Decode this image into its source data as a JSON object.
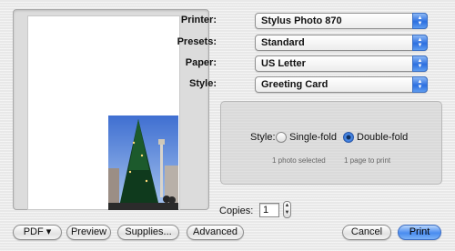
{
  "printer": {
    "label": "Printer:",
    "value": "Stylus Photo 870"
  },
  "presets": {
    "label": "Presets:",
    "value": "Standard"
  },
  "paper": {
    "label": "Paper:",
    "value": "US Letter"
  },
  "style": {
    "label": "Style:",
    "value": "Greeting Card"
  },
  "style_options": {
    "label": "Style:",
    "single_fold": "Single-fold",
    "double_fold": "Double-fold",
    "selected": "Double-fold",
    "photos_selected": "1 photo selected",
    "pages_to_print": "1 page to print"
  },
  "copies": {
    "label": "Copies:",
    "value": "1"
  },
  "buttons": {
    "pdf": "PDF ▾",
    "preview": "Preview",
    "supplies": "Supplies...",
    "advanced": "Advanced",
    "cancel": "Cancel",
    "print": "Print"
  },
  "colors": {
    "accent": "#2c6fe0",
    "background": "#e8e8e8"
  },
  "icons": {
    "popup_arrows": "up-down-arrows-icon",
    "stepper": "stepper-arrows-icon"
  }
}
